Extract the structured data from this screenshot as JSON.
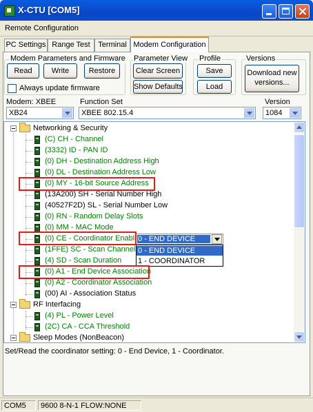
{
  "window": {
    "title": "X-CTU  [COM5]"
  },
  "menu": {
    "label": "Remote Configuration"
  },
  "tabs": [
    {
      "label": "PC Settings"
    },
    {
      "label": "Range Test"
    },
    {
      "label": "Terminal"
    },
    {
      "label": "Modem Configuration"
    }
  ],
  "groups": {
    "modem_params": {
      "title": "Modem Parameters and Firmware",
      "read": "Read",
      "write": "Write",
      "restore": "Restore",
      "always_update": "Always update firmware"
    },
    "param_view": {
      "title": "Parameter View",
      "clear_screen": "Clear Screen",
      "show_defaults": "Show Defaults"
    },
    "profile": {
      "title": "Profile",
      "save": "Save",
      "load": "Load"
    },
    "versions": {
      "title": "Versions",
      "download_line1": "Download new",
      "download_line2": "versions..."
    }
  },
  "selectors": {
    "modem_label": "Modem: XBEE",
    "modem_value": "XB24",
    "function_label": "Function Set",
    "function_value": "XBEE 802.15.4",
    "version_label": "Version",
    "version_value": "1084"
  },
  "tree": {
    "networking": "Networking & Security",
    "ch": "(C) CH - Channel",
    "id": "(3332) ID - PAN ID",
    "dh": "(0) DH - Destination Address High",
    "dl": "(0) DL - Destination Address Low",
    "my": "(0) MY - 16-bit Source Address",
    "sh": "(13A200) SH - Serial Number High",
    "sl": "(40527F2D) SL - Serial Number Low",
    "rn": "(0) RN - Random Delay Slots",
    "mm": "(0) MM - MAC Mode",
    "ce": "(0) CE - Coordinator Enable",
    "sc": "(1FFE) SC - Scan Channels",
    "sd": "(4) SD - Scan Duration",
    "a1": "(0) A1 - End Device Association",
    "a2": "(0) A2 - Coordinator Association",
    "ai": "(00) AI - Association Status",
    "rf": "RF Interfacing",
    "pl": "(4) PL - Power Level",
    "ca": "(2C) CA - CCA Threshold",
    "sleep": "Sleep Modes (NonBeacon)"
  },
  "ce_dropdown": {
    "selected": "0 - END DEVICE",
    "options": [
      "0 - END DEVICE",
      "1 - COORDINATOR"
    ]
  },
  "description": "Set/Read the coordinator setting: 0 - End Device, 1 - Coordinator.",
  "status": {
    "port": "COM5",
    "settings": "9600 8-N-1  FLOW:NONE"
  },
  "colors": {
    "param_text": "#008000",
    "highlight_box": "#e31b1b",
    "selection": "#316ac5"
  }
}
